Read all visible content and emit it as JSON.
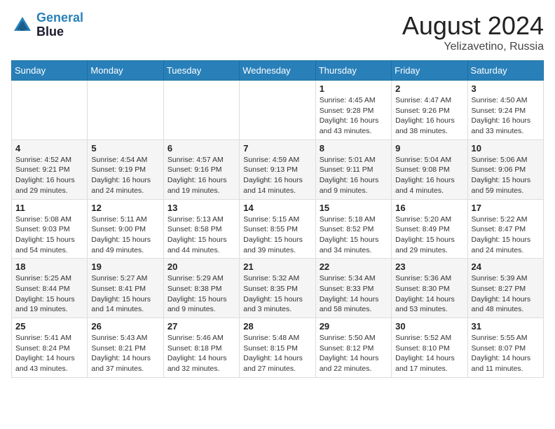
{
  "header": {
    "logo_line1": "General",
    "logo_line2": "Blue",
    "month_year": "August 2024",
    "location": "Yelizavetino, Russia"
  },
  "weekdays": [
    "Sunday",
    "Monday",
    "Tuesday",
    "Wednesday",
    "Thursday",
    "Friday",
    "Saturday"
  ],
  "weeks": [
    [
      {
        "day": "",
        "info": ""
      },
      {
        "day": "",
        "info": ""
      },
      {
        "day": "",
        "info": ""
      },
      {
        "day": "",
        "info": ""
      },
      {
        "day": "1",
        "info": "Sunrise: 4:45 AM\nSunset: 9:28 PM\nDaylight: 16 hours\nand 43 minutes."
      },
      {
        "day": "2",
        "info": "Sunrise: 4:47 AM\nSunset: 9:26 PM\nDaylight: 16 hours\nand 38 minutes."
      },
      {
        "day": "3",
        "info": "Sunrise: 4:50 AM\nSunset: 9:24 PM\nDaylight: 16 hours\nand 33 minutes."
      }
    ],
    [
      {
        "day": "4",
        "info": "Sunrise: 4:52 AM\nSunset: 9:21 PM\nDaylight: 16 hours\nand 29 minutes."
      },
      {
        "day": "5",
        "info": "Sunrise: 4:54 AM\nSunset: 9:19 PM\nDaylight: 16 hours\nand 24 minutes."
      },
      {
        "day": "6",
        "info": "Sunrise: 4:57 AM\nSunset: 9:16 PM\nDaylight: 16 hours\nand 19 minutes."
      },
      {
        "day": "7",
        "info": "Sunrise: 4:59 AM\nSunset: 9:13 PM\nDaylight: 16 hours\nand 14 minutes."
      },
      {
        "day": "8",
        "info": "Sunrise: 5:01 AM\nSunset: 9:11 PM\nDaylight: 16 hours\nand 9 minutes."
      },
      {
        "day": "9",
        "info": "Sunrise: 5:04 AM\nSunset: 9:08 PM\nDaylight: 16 hours\nand 4 minutes."
      },
      {
        "day": "10",
        "info": "Sunrise: 5:06 AM\nSunset: 9:06 PM\nDaylight: 15 hours\nand 59 minutes."
      }
    ],
    [
      {
        "day": "11",
        "info": "Sunrise: 5:08 AM\nSunset: 9:03 PM\nDaylight: 15 hours\nand 54 minutes."
      },
      {
        "day": "12",
        "info": "Sunrise: 5:11 AM\nSunset: 9:00 PM\nDaylight: 15 hours\nand 49 minutes."
      },
      {
        "day": "13",
        "info": "Sunrise: 5:13 AM\nSunset: 8:58 PM\nDaylight: 15 hours\nand 44 minutes."
      },
      {
        "day": "14",
        "info": "Sunrise: 5:15 AM\nSunset: 8:55 PM\nDaylight: 15 hours\nand 39 minutes."
      },
      {
        "day": "15",
        "info": "Sunrise: 5:18 AM\nSunset: 8:52 PM\nDaylight: 15 hours\nand 34 minutes."
      },
      {
        "day": "16",
        "info": "Sunrise: 5:20 AM\nSunset: 8:49 PM\nDaylight: 15 hours\nand 29 minutes."
      },
      {
        "day": "17",
        "info": "Sunrise: 5:22 AM\nSunset: 8:47 PM\nDaylight: 15 hours\nand 24 minutes."
      }
    ],
    [
      {
        "day": "18",
        "info": "Sunrise: 5:25 AM\nSunset: 8:44 PM\nDaylight: 15 hours\nand 19 minutes."
      },
      {
        "day": "19",
        "info": "Sunrise: 5:27 AM\nSunset: 8:41 PM\nDaylight: 15 hours\nand 14 minutes."
      },
      {
        "day": "20",
        "info": "Sunrise: 5:29 AM\nSunset: 8:38 PM\nDaylight: 15 hours\nand 9 minutes."
      },
      {
        "day": "21",
        "info": "Sunrise: 5:32 AM\nSunset: 8:35 PM\nDaylight: 15 hours\nand 3 minutes."
      },
      {
        "day": "22",
        "info": "Sunrise: 5:34 AM\nSunset: 8:33 PM\nDaylight: 14 hours\nand 58 minutes."
      },
      {
        "day": "23",
        "info": "Sunrise: 5:36 AM\nSunset: 8:30 PM\nDaylight: 14 hours\nand 53 minutes."
      },
      {
        "day": "24",
        "info": "Sunrise: 5:39 AM\nSunset: 8:27 PM\nDaylight: 14 hours\nand 48 minutes."
      }
    ],
    [
      {
        "day": "25",
        "info": "Sunrise: 5:41 AM\nSunset: 8:24 PM\nDaylight: 14 hours\nand 43 minutes."
      },
      {
        "day": "26",
        "info": "Sunrise: 5:43 AM\nSunset: 8:21 PM\nDaylight: 14 hours\nand 37 minutes."
      },
      {
        "day": "27",
        "info": "Sunrise: 5:46 AM\nSunset: 8:18 PM\nDaylight: 14 hours\nand 32 minutes."
      },
      {
        "day": "28",
        "info": "Sunrise: 5:48 AM\nSunset: 8:15 PM\nDaylight: 14 hours\nand 27 minutes."
      },
      {
        "day": "29",
        "info": "Sunrise: 5:50 AM\nSunset: 8:12 PM\nDaylight: 14 hours\nand 22 minutes."
      },
      {
        "day": "30",
        "info": "Sunrise: 5:52 AM\nSunset: 8:10 PM\nDaylight: 14 hours\nand 17 minutes."
      },
      {
        "day": "31",
        "info": "Sunrise: 5:55 AM\nSunset: 8:07 PM\nDaylight: 14 hours\nand 11 minutes."
      }
    ]
  ]
}
